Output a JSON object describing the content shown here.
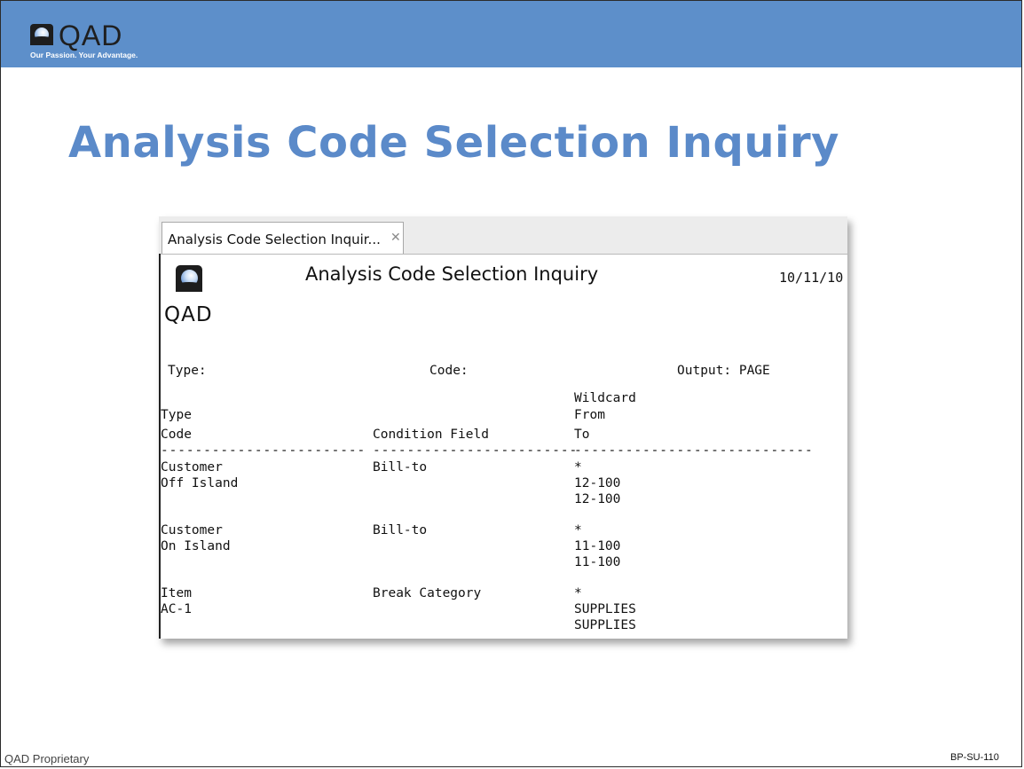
{
  "header": {
    "logo_text": "QAD",
    "tagline": "Our Passion. Your Advantage."
  },
  "slide_title": "Analysis Code Selection Inquiry",
  "window": {
    "tab_label": "Analysis Code Selection Inquir...",
    "tab_close_icon": "close-icon",
    "report": {
      "logo_text": "QAD",
      "title": "Analysis Code Selection Inquiry",
      "date": "10/11/10",
      "filters": {
        "type_label": "Type:",
        "code_label": "Code:",
        "output_label": "Output: PAGE"
      },
      "columns": {
        "col1_line1": "Type",
        "col1_line2": "Code",
        "col2": "Condition Field",
        "col3_line1": "Wildcard",
        "col3_line2": "From",
        "col3_line3": "To",
        "dash1": "------------------------",
        "dash2": "------------------------",
        "dash3": "----------------------------"
      },
      "rows": [
        {
          "type": "Customer",
          "code": "Off Island",
          "condition": "Bill-to",
          "wildcard": "*",
          "from": "12-100",
          "to": "12-100"
        },
        {
          "type": "Customer",
          "code": "On Island",
          "condition": "Bill-to",
          "wildcard": "*",
          "from": "11-100",
          "to": "11-100"
        },
        {
          "type": "Item",
          "code": "AC-1",
          "condition": "Break Category",
          "wildcard": "*",
          "from": "SUPPLIES",
          "to": "SUPPLIES"
        }
      ]
    }
  },
  "footer": {
    "left": "QAD Proprietary",
    "right": "BP-SU-110"
  }
}
